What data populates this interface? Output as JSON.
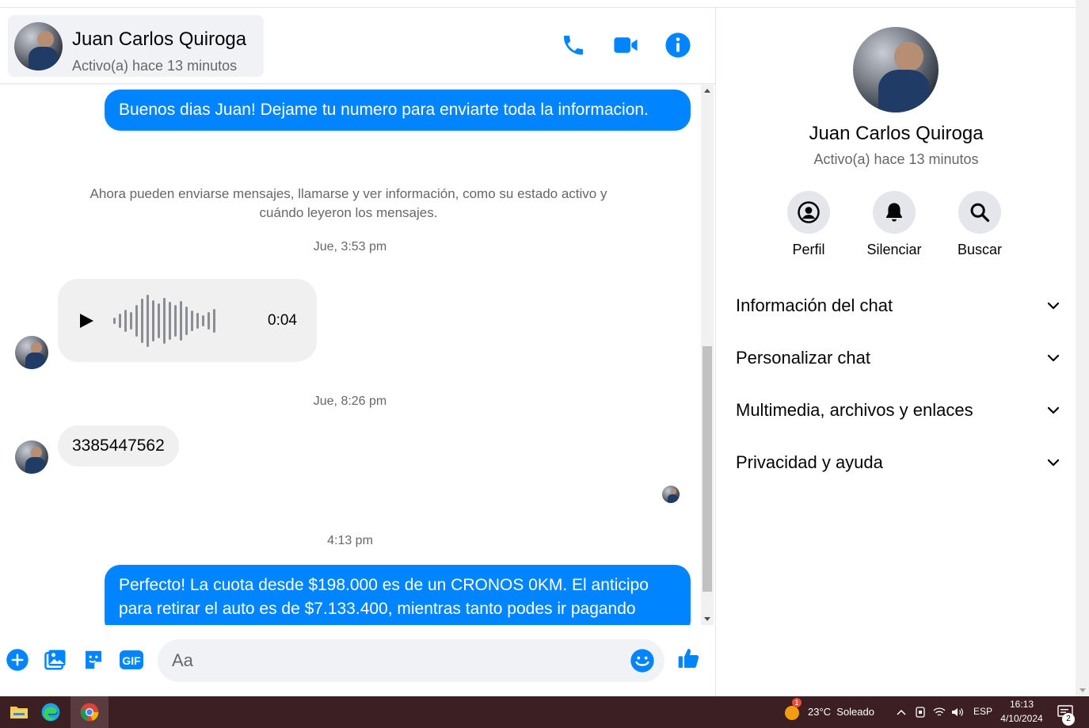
{
  "header": {
    "contact_name": "Juan Carlos Quiroga",
    "contact_status": "Activo(a) hace 13 minutos",
    "icons": [
      "phone-icon",
      "video-call-icon",
      "info-icon"
    ]
  },
  "messages": {
    "outgoing_1": "Buenos dias Juan! Dejame tu numero para enviarte toda la informacion.",
    "system_note": "Ahora pueden enviarse mensajes, llamarse y ver información, como su estado activo y cuándo leyeron los mensajes.",
    "time_1": "Jue, 3:53 pm",
    "voice_duration": "0:04",
    "time_2": "Jue, 8:26 pm",
    "incoming_number": "3385447562",
    "time_3": "4:13 pm",
    "outgoing_2": "Perfecto! La cuota desde $198.000 es de un CRONOS 0KM. El anticipo para retirar el auto es de $7.133.400, mientras tanto podes ir pagando"
  },
  "composer": {
    "placeholder": "Aa",
    "icons": [
      "plus-icon",
      "image-icon",
      "sticker-icon",
      "gif-icon",
      "emoji-icon",
      "like-icon"
    ],
    "gif_label": "GIF"
  },
  "sidebar": {
    "name": "Juan Carlos Quiroga",
    "status": "Activo(a) hace 13 minutos",
    "actions": [
      {
        "label": "Perfil",
        "icon": "profile-icon"
      },
      {
        "label": "Silenciar",
        "icon": "bell-icon"
      },
      {
        "label": "Buscar",
        "icon": "search-icon"
      }
    ],
    "sections": [
      "Información del chat",
      "Personalizar chat",
      "Multimedia, archivos y enlaces",
      "Privacidad y ayuda"
    ]
  },
  "taskbar": {
    "weather": "23°C  Soleado",
    "weather_badge": "1",
    "language": "ESP",
    "time": "16:13",
    "date": "4/10/2024",
    "notifications": "2"
  },
  "colors": {
    "accent": "#0084ff",
    "bubble_in": "#f0f0f0",
    "secondary_text": "#65676b",
    "taskbar": "#3b1f22"
  }
}
